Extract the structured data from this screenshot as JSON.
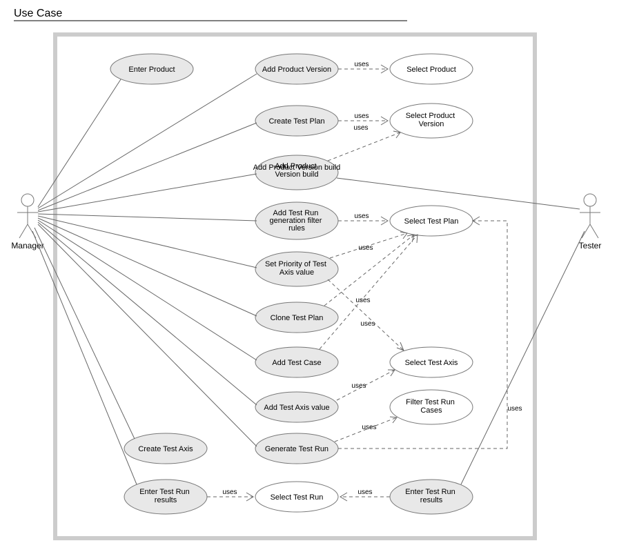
{
  "diagram": {
    "title": "Use Case",
    "actors": {
      "manager": "Manager",
      "tester": "Tester"
    },
    "usecases": {
      "enter_product": "Enter Product",
      "add_product_version": "Add Product Version",
      "create_test_plan": "Create Test Plan",
      "add_product_version_build": "Add Product Version build",
      "add_test_run_gen_filter_rules_l1": "Add Test Run",
      "add_test_run_gen_filter_rules_l2": "generation filter",
      "add_test_run_gen_filter_rules_l3": "rules",
      "set_priority_test_axis_value_l1": "Set Priority of Test",
      "set_priority_test_axis_value_l2": "Axis value",
      "clone_test_plan": "Clone Test Plan",
      "add_test_case": "Add Test Case",
      "add_test_axis_value": "Add Test Axis value",
      "create_test_axis": "Create Test Axis",
      "generate_test_run": "Generate Test Run",
      "enter_test_run_results_left_l1": "Enter Test Run",
      "enter_test_run_results_left_l2": "results",
      "enter_test_run_results_right_l1": "Enter Test Run",
      "enter_test_run_results_right_l2": "results",
      "select_product": "Select Product",
      "select_product_version_l1": "Select Product",
      "select_product_version_l2": "Version",
      "select_test_plan": "Select Test Plan",
      "select_test_axis": "Select Test Axis",
      "filter_test_run_cases_l1": "Filter Test Run",
      "filter_test_run_cases_l2": "Cases",
      "select_test_run": "Select Test Run"
    },
    "labels": {
      "uses": "uses"
    }
  }
}
